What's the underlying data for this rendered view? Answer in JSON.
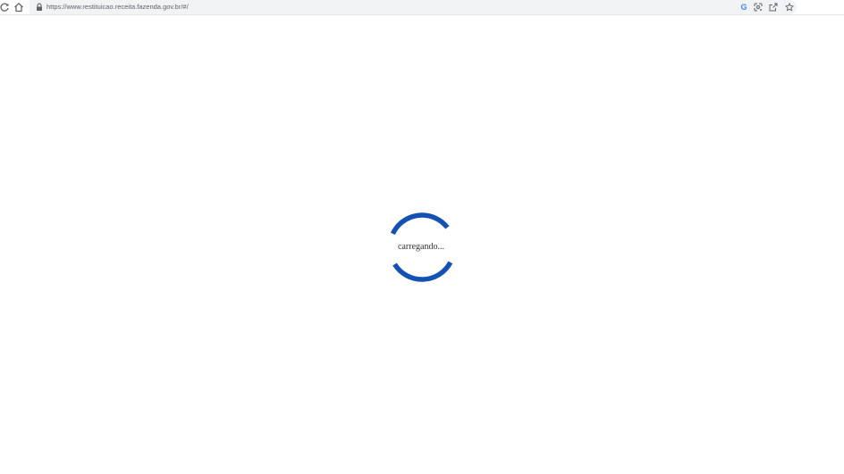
{
  "browser": {
    "url": "https://www.restituicao.receita.fazenda.gov.br/#/",
    "icons": {
      "reload": "reload-icon",
      "home": "home-icon",
      "lock": "lock-icon",
      "google": "google-icon",
      "google_letter": "G",
      "lens": "google-lens-icon",
      "share": "share-icon",
      "bookmark": "star-icon"
    }
  },
  "page": {
    "loading_text": "carregando...",
    "spinner_color": "#1351b4"
  }
}
